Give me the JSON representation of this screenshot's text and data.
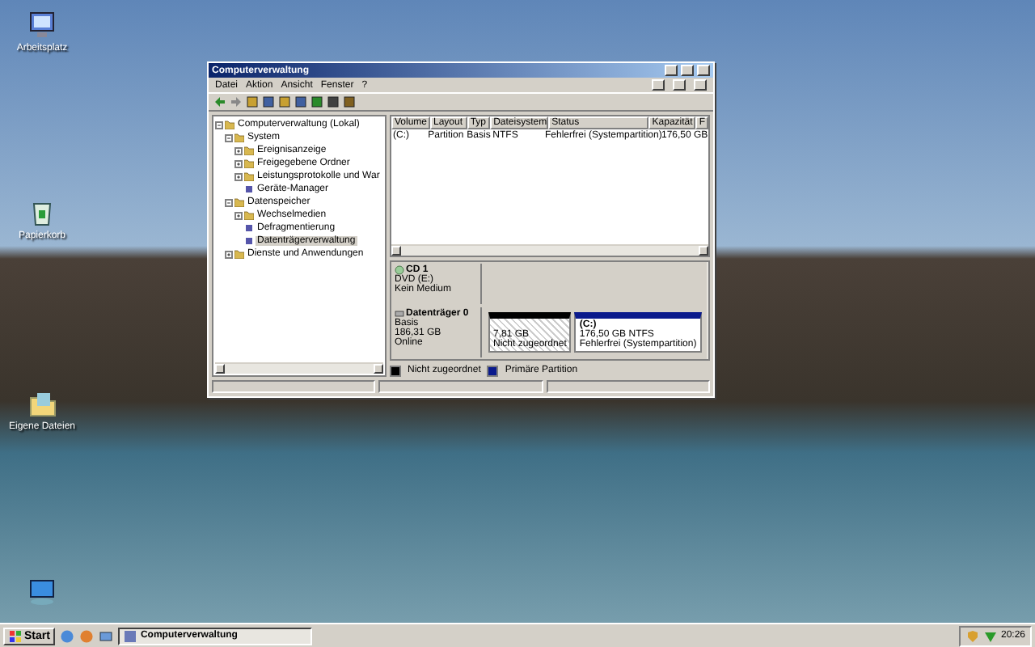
{
  "desktop_icons": [
    {
      "kind": "computer",
      "label": "Arbeitsplatz"
    },
    {
      "kind": "bin",
      "label": "Papierkorb"
    },
    {
      "kind": "documents",
      "label": "Eigene Dateien"
    },
    {
      "kind": "network"
    }
  ],
  "window": {
    "title": "Computerverwaltung",
    "menu": [
      "Datei",
      "Aktion",
      "Ansicht",
      "Fenster",
      "?"
    ],
    "tree": [
      {
        "label": "Computerverwaltung (Lokal)",
        "kind": "root",
        "selected": false,
        "expanded": true,
        "children": [
          {
            "label": "System",
            "kind": "group",
            "selected": false,
            "expanded": true,
            "children": [
              {
                "label": "Ereignisanzeige",
                "kind": "group",
                "selected": false,
                "expanded": false
              },
              {
                "label": "Freigegebene Ordner",
                "kind": "group",
                "selected": false,
                "expanded": false
              },
              {
                "label": "Leistungsprotokolle und War",
                "kind": "group",
                "selected": false,
                "expanded": false
              },
              {
                "label": "Geräte-Manager",
                "kind": "leaf",
                "selected": false
              }
            ]
          },
          {
            "label": "Datenspeicher",
            "kind": "group",
            "selected": false,
            "expanded": true,
            "children": [
              {
                "label": "Wechselmedien",
                "kind": "group",
                "selected": false,
                "expanded": false
              },
              {
                "label": "Defragmentierung",
                "kind": "leaf",
                "selected": false
              },
              {
                "label": "Datenträgerverwaltung",
                "kind": "leaf",
                "selected": true
              }
            ]
          },
          {
            "label": "Dienste und Anwendungen",
            "kind": "group",
            "selected": false,
            "expanded": false
          }
        ]
      }
    ],
    "table": {
      "columns": [
        "Volume",
        "Layout",
        "Typ",
        "Dateisystem",
        "Status",
        "Kapazität",
        "F"
      ],
      "rows": [
        [
          "(C:)",
          "Partition",
          "Basis",
          "NTFS",
          "Fehlerfrei (Systempartition)",
          "176,50 GB"
        ]
      ]
    },
    "disks": [
      {
        "kind": "cdrom",
        "name": "CD 1",
        "lines": [
          "DVD (E:)",
          "Kein Medium"
        ]
      },
      {
        "kind": "disk",
        "name": "Datenträger 0",
        "lines": [
          "Basis",
          "186,31 GB",
          "Online"
        ],
        "partitions": [
          {
            "kind": "unallocated",
            "lines": [
              "7,81 GB",
              "Nicht zugeordnet"
            ]
          },
          {
            "kind": "primary",
            "title": "(C:)",
            "lines": [
              "176,50 GB NTFS",
              "Fehlerfrei (Systempartition)"
            ]
          }
        ]
      }
    ],
    "legend": [
      {
        "kind": "unallocated",
        "label": "Nicht zugeordnet"
      },
      {
        "kind": "primary",
        "label": "Primäre Partition"
      }
    ]
  },
  "taskbar": {
    "start": "Start",
    "tasks": [
      {
        "label": "Computerverwaltung",
        "selected": true
      }
    ],
    "clock": "20:26"
  }
}
